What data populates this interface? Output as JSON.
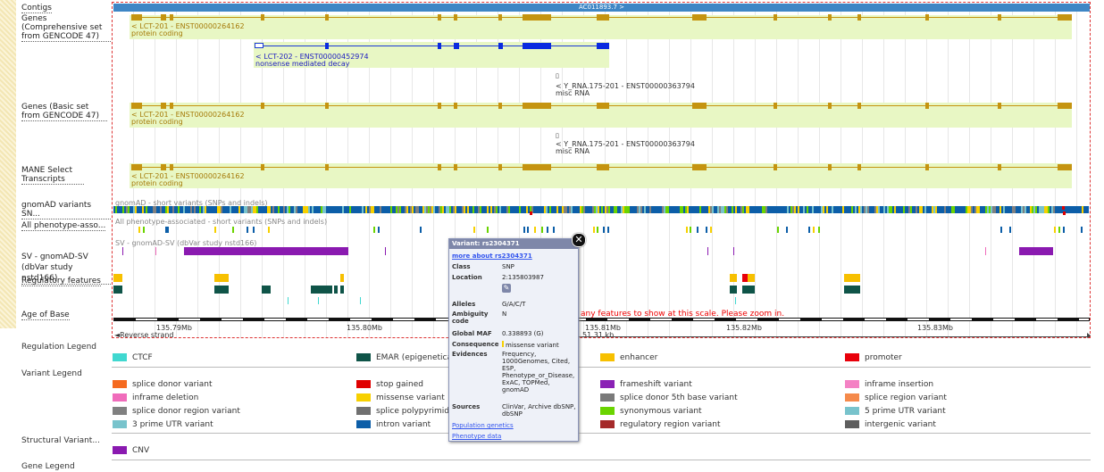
{
  "labels": {
    "contigs": "Contigs",
    "genes_comp": "Genes (Comprehensive set from GENCODE 47)",
    "genes_basic": "Genes (Basic set from GENCODE 47)",
    "mane": "MANE Select Transcripts",
    "gnomad": "gnomAD variants SN...",
    "phenotype": "All phenotype-asso...",
    "sv": "SV - gnomAD-SV (dbVar study nstd166)",
    "regulatory": "Regulatory features",
    "age": "Age of Base"
  },
  "tracks": {
    "contig_name": "AC011893.7 >",
    "lct201_name": "< LCT-201 - ENST00000264162",
    "lct201_type": "protein coding",
    "lct202_name": "< LCT-202 - ENST00000452974",
    "lct202_type": "nonsense mediated decay",
    "yrna_name": "< Y_RNA.175-201 - ENST00000363794",
    "yrna_type": "misc RNA",
    "gnomad_title": "gnomAD - short variants (SNPs and indels)",
    "pheno_title": "All phenotype-associated - short variants (SNPs and indels)",
    "sv_title": "SV - gnomAD-SV (dbVar study nstd166)",
    "zoom_warning": "any features to show at this scale. Please zoom in."
  },
  "scale": {
    "ticks": [
      "135.79Mb",
      "135.80Mb",
      "135.81Mb",
      "135.82Mb",
      "135.83Mb"
    ],
    "strand": "Reverse strand",
    "length": "51.31 kb"
  },
  "legends": {
    "regulation": {
      "title": "Regulation Legend",
      "items": [
        {
          "label": "CTCF",
          "color": "#40d8d0"
        },
        {
          "label": "EMAR (epigenetical",
          "color": "#0f5448"
        },
        {
          "label": "enhancer",
          "color": "#f7c000"
        },
        {
          "label": "promoter",
          "color": "#e8000a"
        }
      ]
    },
    "variant": {
      "title": "Variant Legend",
      "items": [
        {
          "label": "splice donor variant",
          "color": "#f56a1f"
        },
        {
          "label": "stop gained",
          "color": "#e00000"
        },
        {
          "label": "frameshift variant",
          "color": "#8a21b5"
        },
        {
          "label": "inframe insertion",
          "color": "#f481c4"
        },
        {
          "label": "inframe deletion",
          "color": "#f06cbb"
        },
        {
          "label": "missense variant",
          "color": "#f7d000"
        },
        {
          "label": "splice donor 5th base variant",
          "color": "#7a7a7a"
        },
        {
          "label": "splice region variant",
          "color": "#f58a4b"
        },
        {
          "label": "splice donor region variant",
          "color": "#808080"
        },
        {
          "label": "splice polypyrimidin",
          "color": "#707070"
        },
        {
          "label": "synonymous variant",
          "color": "#6ad400"
        },
        {
          "label": "5 prime UTR variant",
          "color": "#78c3cc"
        },
        {
          "label": "3 prime UTR variant",
          "color": "#78c3cc"
        },
        {
          "label": "intron variant",
          "color": "#0c5ea8"
        },
        {
          "label": "regulatory region variant",
          "color": "#a52a2a"
        },
        {
          "label": "intergenic variant",
          "color": "#5e5e5e"
        }
      ]
    },
    "structural": {
      "title": "Structural Variant...",
      "items": [
        {
          "label": "CNV",
          "color": "#8a1ab0"
        }
      ]
    },
    "gene": {
      "title": "Gene Legend"
    }
  },
  "popup": {
    "title": "Variant: rs2304371",
    "more_link": "more about rs2304371",
    "rows": {
      "class_k": "Class",
      "class_v": "SNP",
      "location_k": "Location",
      "location_v": "2:135803987",
      "alleles_k": "Alleles",
      "alleles_v": "G/A/C/T",
      "ambiguity_k": "Ambiguity code",
      "ambiguity_v": "N",
      "maf_k": "Global MAF",
      "maf_v": "0.338893 (G)",
      "consequence_k": "Consequence",
      "consequence_v": "missense variant",
      "evidences_k": "Evidences",
      "evidences_v": "Frequency, 1000Genomes, Cited, ESP, Phenotype_or_Disease, ExAC, TOPMed, gnomAD",
      "sources_k": "Sources",
      "sources_v": "ClinVar, Archive dbSNP, dbSNP"
    },
    "pop_link": "Population genetics",
    "pheno_link": "Phenotype data"
  },
  "colors": {
    "gene_gold": "#c59410",
    "nmd_blue": "#0a2ae0",
    "contig_blue": "#3e86c5",
    "intron_blue": "#0c5ea8",
    "cnv_purple": "#8a1ab0"
  }
}
